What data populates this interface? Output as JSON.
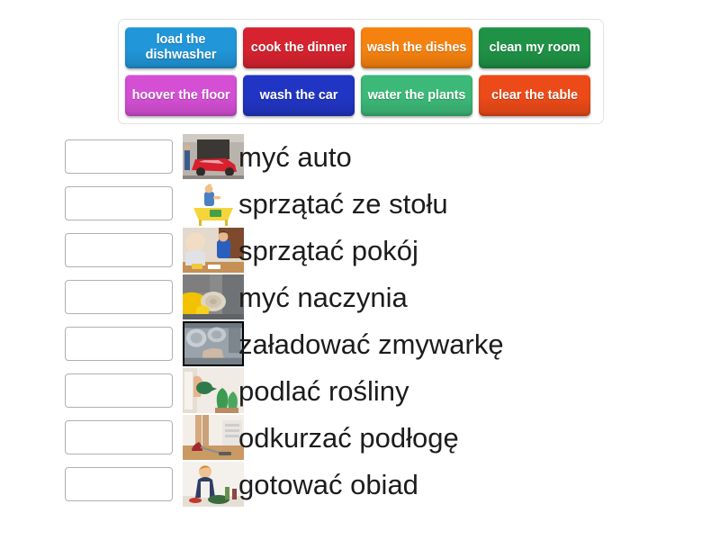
{
  "page": {
    "background_color": "#ffffff",
    "text_color": "#1c1c1c"
  },
  "tile_bank": {
    "border_color": "#e2e2e2",
    "tiles": [
      {
        "label": "load the dishwasher",
        "color": "#2196d9",
        "icon": "drag-tile"
      },
      {
        "label": "cook the dinner",
        "color": "#d6232f",
        "icon": "drag-tile"
      },
      {
        "label": "wash the dishes",
        "color": "#f5820f",
        "icon": "drag-tile"
      },
      {
        "label": "clean my room",
        "color": "#1f9246",
        "icon": "drag-tile"
      },
      {
        "label": "hoover the floor",
        "color": "#d44fd4",
        "icon": "drag-tile"
      },
      {
        "label": "wash the car",
        "color": "#2135c4",
        "icon": "drag-tile"
      },
      {
        "label": "water the plants",
        "color": "#3cb878",
        "icon": "drag-tile"
      },
      {
        "label": "clear the table",
        "color": "#ec4a18",
        "icon": "drag-tile"
      }
    ]
  },
  "answers": {
    "rows": [
      {
        "label": "myć auto",
        "thumb": "washing-car-photo",
        "framed": false
      },
      {
        "label": "sprzątać ze stołu",
        "thumb": "clearing-table-photo",
        "framed": false
      },
      {
        "label": "sprzątać pokój",
        "thumb": "tidying-room-photo",
        "framed": false
      },
      {
        "label": "myć naczynia",
        "thumb": "washing-dishes-photo",
        "framed": false
      },
      {
        "label": "załadować zmywarkę",
        "thumb": "dishwasher-photo",
        "framed": true
      },
      {
        "label": "podlać rośliny",
        "thumb": "watering-plants-photo",
        "framed": false
      },
      {
        "label": "odkurzać podłogę",
        "thumb": "vacuuming-floor-photo",
        "framed": false
      },
      {
        "label": "gotować obiad",
        "thumb": "cooking-dinner-photo",
        "framed": false
      }
    ]
  }
}
